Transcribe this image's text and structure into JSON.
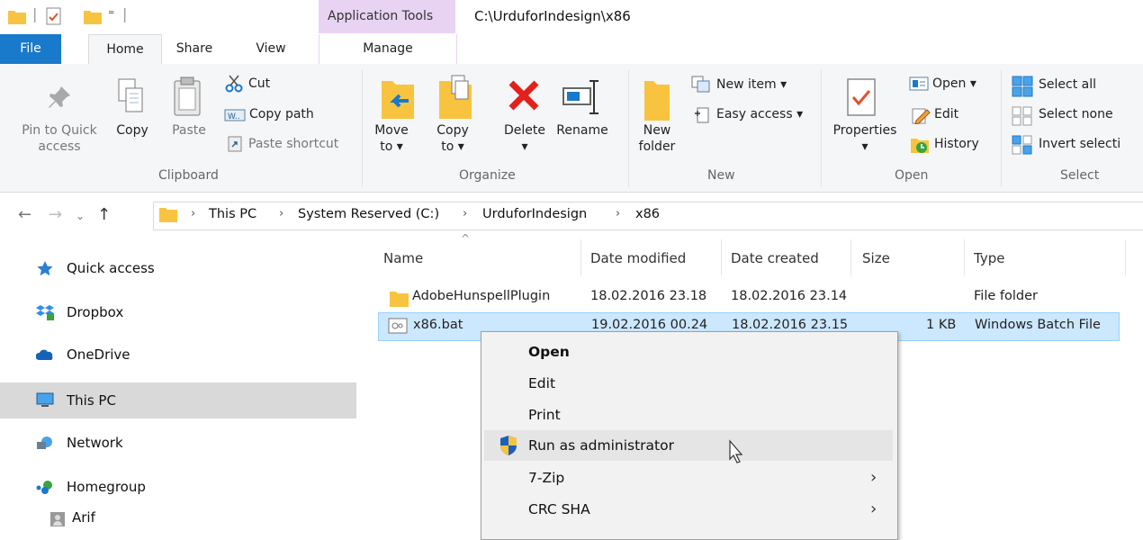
{
  "titlebar": {
    "app_tools_label": "Application Tools",
    "path": "C:\\UrduforIndesign\\x86"
  },
  "tabs": {
    "file": "File",
    "home": "Home",
    "share": "Share",
    "view": "View",
    "manage": "Manage"
  },
  "ribbon": {
    "clipboard": {
      "pin": "Pin to Quick access",
      "pin_line1": "Pin to Quick",
      "pin_line2": "access",
      "copy": "Copy",
      "paste": "Paste",
      "cut": "Cut",
      "copy_path": "Copy path",
      "paste_shortcut": "Paste shortcut",
      "label": "Clipboard"
    },
    "organize": {
      "move_to": "Move",
      "move_to2": "to ▾",
      "copy_to": "Copy",
      "copy_to2": "to ▾",
      "delete": "Delete",
      "delete2": "▾",
      "rename": "Rename",
      "label": "Organize"
    },
    "new": {
      "new_folder": "New",
      "new_folder2": "folder",
      "new_item": "New item ▾",
      "easy_access": "Easy access ▾",
      "label": "New"
    },
    "open": {
      "properties": "Properties",
      "properties2": "▾",
      "open": "Open ▾",
      "edit": "Edit",
      "history": "History",
      "label": "Open"
    },
    "select": {
      "select_all": "Select all",
      "select_none": "Select none",
      "invert": "Invert selecti",
      "label": "Select"
    }
  },
  "address": {
    "crumbs": [
      "This PC",
      "System Reserved (C:)",
      "UrduforIndesign",
      "x86"
    ],
    "sep": "›"
  },
  "sidebar": {
    "items": [
      {
        "label": "Quick access"
      },
      {
        "label": "Dropbox"
      },
      {
        "label": "OneDrive"
      },
      {
        "label": "This PC"
      },
      {
        "label": "Network"
      },
      {
        "label": "Homegroup"
      },
      {
        "label": "Arif"
      }
    ]
  },
  "columns": {
    "name": "Name",
    "modified": "Date modified",
    "created": "Date created",
    "size": "Size",
    "type": "Type"
  },
  "files": [
    {
      "name": "AdobeHunspellPlugin",
      "modified": "18.02.2016 23.18",
      "created": "18.02.2016 23.14",
      "size": "",
      "type": "File folder"
    },
    {
      "name": "x86.bat",
      "modified": "19.02.2016 00.24",
      "created": "18.02.2016 23.15",
      "size": "1 KB",
      "type": "Windows Batch File"
    }
  ],
  "context_menu": {
    "items": [
      {
        "label": "Open"
      },
      {
        "label": "Edit"
      },
      {
        "label": "Print"
      },
      {
        "label": "Run as administrator"
      },
      {
        "label": "7-Zip"
      },
      {
        "label": "CRC SHA"
      }
    ],
    "submenu_arrow": "›"
  },
  "colors": {
    "accent": "#1979ca",
    "selection": "#cce8ff",
    "app_tools": "#e8d3f3"
  }
}
